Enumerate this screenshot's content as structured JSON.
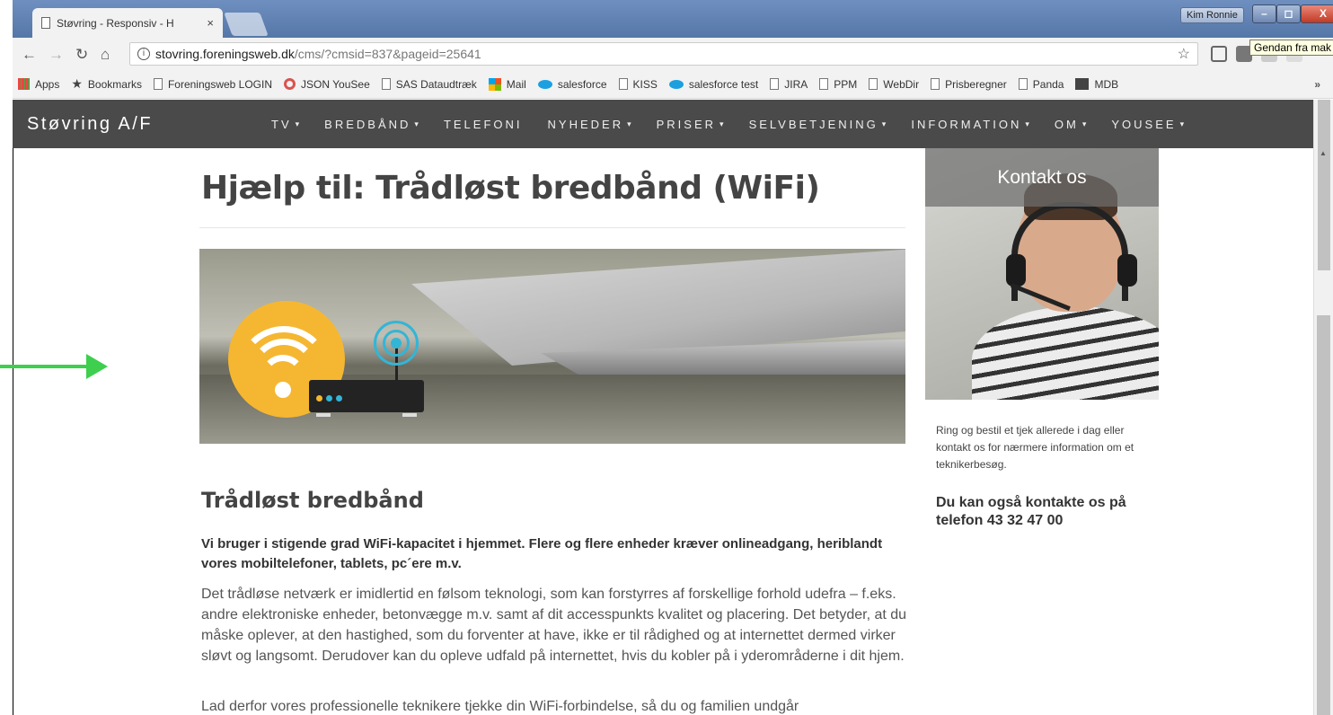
{
  "browser": {
    "tab_title": "Støvring - Responsiv - H",
    "tab_close": "×",
    "user_name": "Kim Ronnie",
    "tooltip": "Gendan fra mak",
    "window_buttons": {
      "minimize": "–",
      "maximize": "◻",
      "close": "X"
    },
    "nav": {
      "back": "←",
      "forward": "→",
      "reload": "↻",
      "home": "⌂"
    },
    "address": {
      "host": "stovring.foreningsweb.dk",
      "path": "/cms/?cmsid=837&pageid=25641",
      "info": "i",
      "star": "☆"
    },
    "bookmarks": [
      {
        "label": "Apps",
        "icon": "apps-icon"
      },
      {
        "label": "Bookmarks",
        "icon": "star-icon"
      },
      {
        "label": "Foreningsweb LOGIN",
        "icon": "page-icon"
      },
      {
        "label": "JSON YouSee",
        "icon": "circle-icon"
      },
      {
        "label": "SAS Dataudtræk",
        "icon": "page-icon"
      },
      {
        "label": "Mail",
        "icon": "windows-icon"
      },
      {
        "label": "salesforce",
        "icon": "cloud-icon"
      },
      {
        "label": "KISS",
        "icon": "page-icon"
      },
      {
        "label": "salesforce test",
        "icon": "cloud-icon"
      },
      {
        "label": "JIRA",
        "icon": "page-icon"
      },
      {
        "label": "PPM",
        "icon": "page-icon"
      },
      {
        "label": "WebDir",
        "icon": "page-icon"
      },
      {
        "label": "Prisberegner",
        "icon": "page-icon"
      },
      {
        "label": "Panda",
        "icon": "page-icon"
      },
      {
        "label": "MDB",
        "icon": "mdb-icon"
      }
    ],
    "bookmarks_more": "»"
  },
  "site": {
    "brand": "Støvring A/F",
    "nav": [
      {
        "label": "TV",
        "dropdown": true
      },
      {
        "label": "BREDBÅND",
        "dropdown": true
      },
      {
        "label": "TELEFONI",
        "dropdown": false
      },
      {
        "label": "NYHEDER",
        "dropdown": true
      },
      {
        "label": "PRISER",
        "dropdown": true
      },
      {
        "label": "SELVBETJENING",
        "dropdown": true
      },
      {
        "label": "INFORMATION",
        "dropdown": true
      },
      {
        "label": "OM",
        "dropdown": true
      },
      {
        "label": "YOUSEE",
        "dropdown": true
      }
    ],
    "caret": "▾"
  },
  "main": {
    "title": "Hjælp til: Trådløst bredbånd (WiFi)",
    "section_title": "Trådløst bredbånd",
    "lead": "Vi bruger i stigende grad WiFi-kapacitet i hjemmet. Flere og flere enheder kræver onlineadgang, heriblandt vores mobiltelefoner, tablets, pc´ere m.v.",
    "paragraph1": "Det trådløse netværk er imidlertid en følsom teknologi, som kan forstyrres af forskellige forhold udefra – f.eks. andre elektroniske enheder, betonvægge m.v. samt af dit accesspunkts kvalitet og placering. Det betyder, at du måske oplever, at den hastighed, som du forventer at have, ikke er til rådighed og at internettet dermed virker sløvt og langsomt. Derudover kan du opleve udfald på internettet, hvis du kobler på i yderområderne i dit hjem.",
    "paragraph2": "Lad derfor vores professionelle teknikere tjekke din WiFi-forbindelse, så du og familien undgår"
  },
  "sidebar": {
    "contact_title": "Kontakt os",
    "text": "Ring og bestil et tjek allerede i dag eller kontakt os for nærmere information om et teknikerbesøg.",
    "bold": "Du kan også kontakte os på telefon 43 32 47 00"
  },
  "colors": {
    "nav_bg": "#4a4a4a",
    "arrow": "#3ecf4f",
    "wifi": "#f5b731",
    "signal": "#33b5d6"
  }
}
